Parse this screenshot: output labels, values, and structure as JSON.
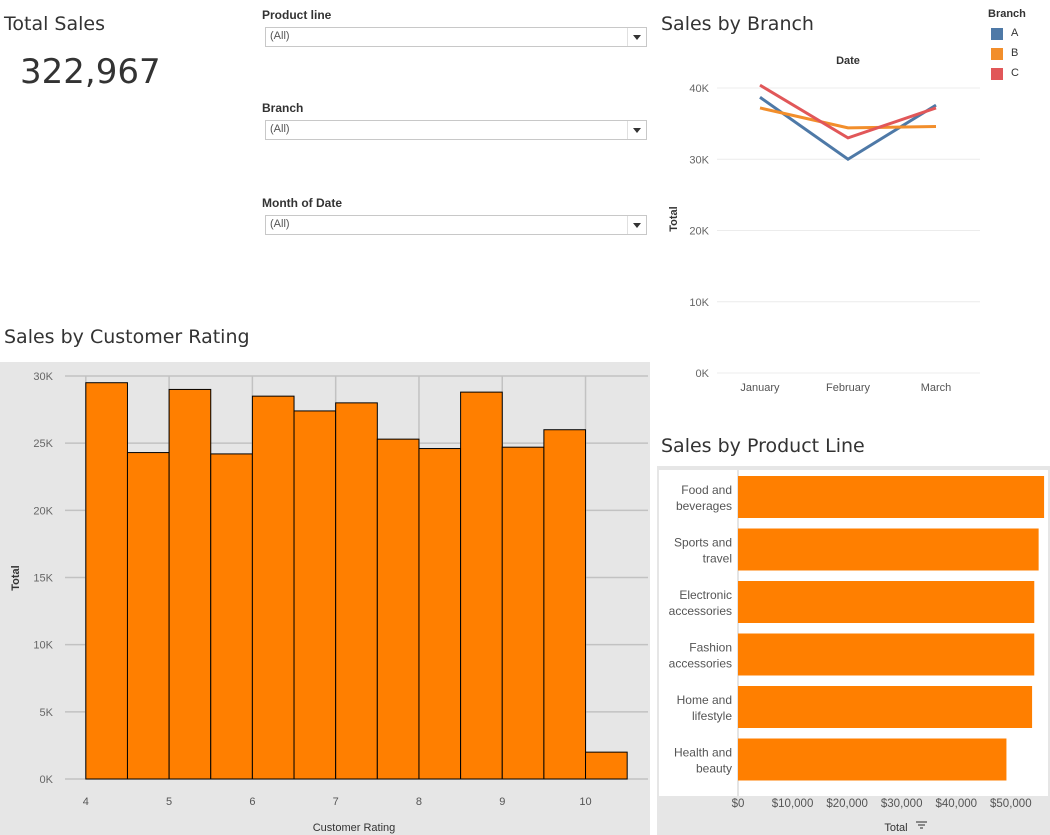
{
  "total_sales": {
    "title": "Total Sales",
    "value": "322,967"
  },
  "filters": [
    {
      "label": "Product line",
      "value": "(All)"
    },
    {
      "label": "Branch",
      "value": "(All)"
    },
    {
      "label": "Month of Date",
      "value": "(All)"
    }
  ],
  "colors": {
    "orange": "#ff7f00",
    "panel_bg": "#e6e6e6",
    "branch_A": "#4e79a7",
    "branch_B": "#f28e2b",
    "branch_C": "#e15759"
  },
  "chart_data": [
    {
      "type": "line",
      "title": "Sales by Branch",
      "header": "Date",
      "xlabel": "",
      "ylabel": "Total",
      "categories": [
        "January",
        "February",
        "March"
      ],
      "ylim": [
        0,
        40000
      ],
      "yticks": [
        0,
        10000,
        20000,
        30000,
        40000
      ],
      "ytick_labels": [
        "0K",
        "10K",
        "20K",
        "30K",
        "40K"
      ],
      "grid": true,
      "legend": {
        "title": "Branch",
        "placement": "top-right",
        "entries": [
          "A",
          "B",
          "C"
        ]
      },
      "series": [
        {
          "name": "A",
          "color": "#4e79a7",
          "values": [
            38700,
            30000,
            37600
          ]
        },
        {
          "name": "B",
          "color": "#f28e2b",
          "values": [
            37200,
            34400,
            34600
          ]
        },
        {
          "name": "C",
          "color": "#e15759",
          "values": [
            40400,
            33000,
            37200
          ]
        }
      ]
    },
    {
      "type": "bar",
      "title": "Sales by Customer Rating",
      "xlabel": "Customer Rating",
      "ylabel": "Total",
      "bin_width": 0.5,
      "bins_start": [
        4,
        4.5,
        5,
        5.5,
        6,
        6.5,
        7,
        7.5,
        8,
        8.5,
        9,
        9.5,
        10
      ],
      "values": [
        29500,
        24300,
        29000,
        24200,
        28500,
        27400,
        28000,
        25300,
        24600,
        28800,
        24700,
        26000,
        2000
      ],
      "xlim": [
        3.75,
        10.75
      ],
      "xticks": [
        "4",
        "5",
        "6",
        "7",
        "8",
        "9",
        "10"
      ],
      "ylim": [
        0,
        30000
      ],
      "yticks": [
        0,
        5000,
        10000,
        15000,
        20000,
        25000,
        30000
      ],
      "ytick_labels": [
        "0K",
        "5K",
        "10K",
        "15K",
        "20K",
        "25K",
        "30K"
      ],
      "grid": true
    },
    {
      "type": "bar",
      "orientation": "horizontal",
      "title": "Sales by Product Line",
      "xlabel": "Total",
      "ylabel": "",
      "categories": [
        [
          "Food and",
          "beverages"
        ],
        [
          "Sports and",
          "travel"
        ],
        [
          "Electronic",
          "accessories"
        ],
        [
          "Fashion",
          "accessories"
        ],
        [
          "Home and",
          "lifestyle"
        ],
        [
          "Health and",
          "beauty"
        ]
      ],
      "values": [
        56100,
        55100,
        54300,
        54300,
        53900,
        49200
      ],
      "xlim": [
        0,
        57000
      ],
      "xticks": [
        0,
        10000,
        20000,
        30000,
        40000,
        50000
      ],
      "xtick_labels": [
        "$0",
        "$10,000",
        "$20,000",
        "$30,000",
        "$40,000",
        "$50,000"
      ],
      "sorted": "descending"
    }
  ]
}
